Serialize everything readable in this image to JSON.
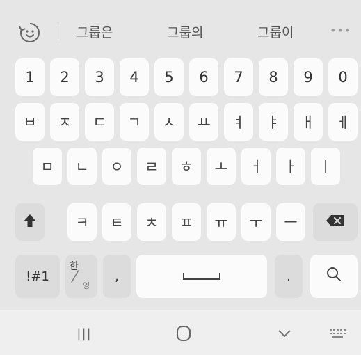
{
  "suggestions": {
    "icon": "sticker-face-icon",
    "words": [
      "그룹은",
      "그룹의",
      "그룹이"
    ],
    "more": "•••"
  },
  "rows": {
    "numbers": [
      "1",
      "2",
      "3",
      "4",
      "5",
      "6",
      "7",
      "8",
      "9",
      "0"
    ],
    "row1": [
      "ㅂ",
      "ㅈ",
      "ㄷ",
      "ㄱ",
      "ㅅ",
      "ㅛ",
      "ㅕ",
      "ㅑ",
      "ㅐ",
      "ㅔ"
    ],
    "row2": [
      "ㅁ",
      "ㄴ",
      "ㅇ",
      "ㄹ",
      "ㅎ",
      "ㅗ",
      "ㅓ",
      "ㅏ",
      "ㅣ"
    ],
    "row3": [
      "ㅋ",
      "ㅌ",
      "ㅊ",
      "ㅍ",
      "ㅠ",
      "ㅜ",
      "ㅡ"
    ]
  },
  "bottom": {
    "symbols_label": "!#1",
    "lang_top": "한",
    "lang_bottom": "영",
    "comma": ",",
    "period": ".",
    "space_icon": "space-bar-icon",
    "search_icon": "search-icon"
  },
  "icons": {
    "shift": "shift-arrow-icon",
    "backspace": "backspace-icon",
    "nav_recent": "recent-apps-icon",
    "nav_home": "home-icon",
    "nav_back": "hide-keyboard-chevron-icon",
    "nav_keyboard": "keyboard-icon"
  },
  "nav_recent_glyph": "|||",
  "colors": {
    "background": "#e6e6e6",
    "key": "#fbfbfb",
    "function_key": "#dcdcdc",
    "navbar": "#efefef"
  }
}
